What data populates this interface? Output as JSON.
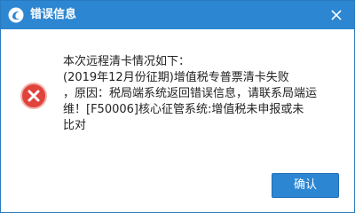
{
  "dialog": {
    "title": "错误信息",
    "icon": "error-icon",
    "message_lines": [
      "本次远程清卡情况如下：",
      "(2019年12月份征期)增值税专普票清卡失败",
      "，原因：税局端系统返回错误信息，请联系局端运",
      "维！[F50006]核心征管系统:增值税未申报或未",
      "比对"
    ],
    "ok_label": "确认"
  },
  "colors": {
    "titlebar": "#2c86d2",
    "button": "#2c86d2",
    "error_red": "#e0433b"
  }
}
